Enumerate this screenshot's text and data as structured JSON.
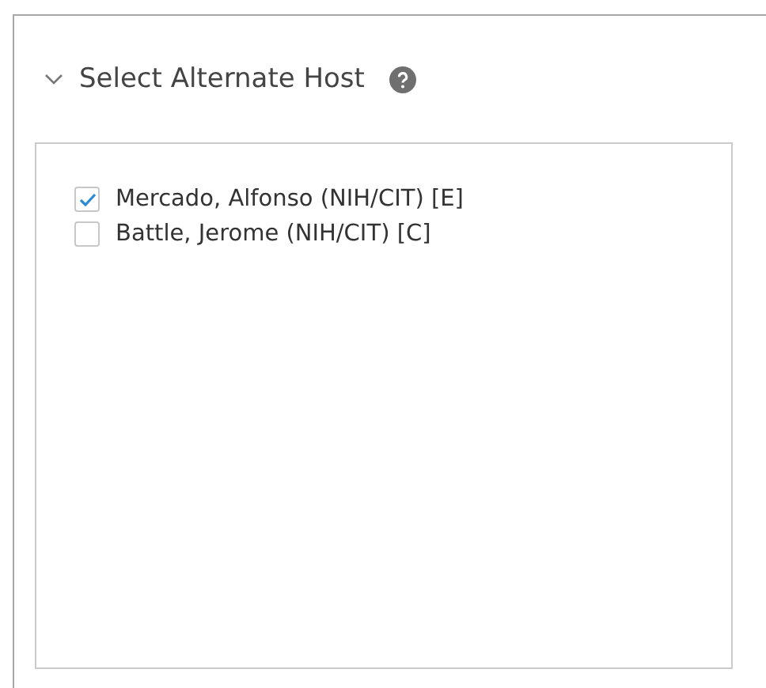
{
  "section": {
    "title": "Select Alternate Host",
    "expanded": true,
    "hosts": [
      {
        "label": "Mercado, Alfonso (NIH/CIT) [E]",
        "checked": true
      },
      {
        "label": "Battle, Jerome (NIH/CIT) [C]",
        "checked": false
      }
    ]
  }
}
